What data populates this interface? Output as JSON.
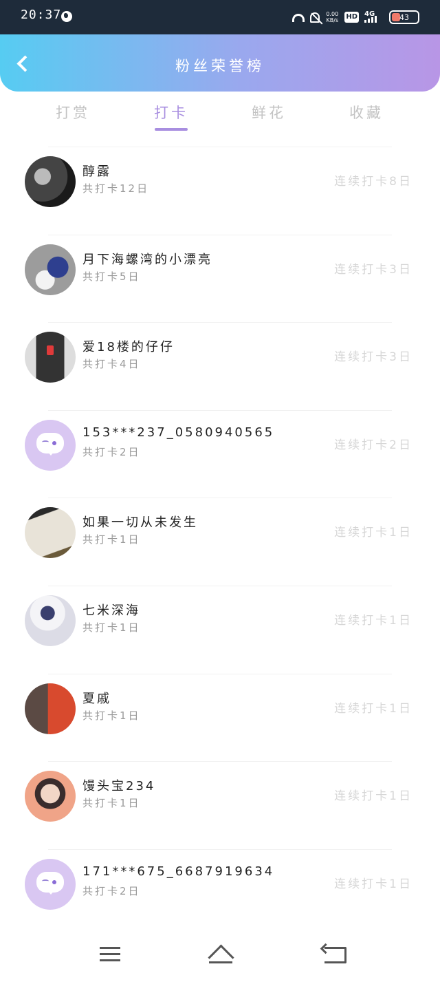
{
  "status_bar": {
    "time": "20:37",
    "net_speed_value": "0.00",
    "net_speed_unit": "KB/s",
    "hd_label": "HD",
    "network_label": "4G",
    "battery_level": "43"
  },
  "header": {
    "title": "粉丝荣誉榜"
  },
  "tabs": [
    {
      "label": "打赏",
      "active": false
    },
    {
      "label": "打卡",
      "active": true
    },
    {
      "label": "鲜花",
      "active": false
    },
    {
      "label": "收藏",
      "active": false
    }
  ],
  "fans": [
    {
      "name": "醇露",
      "total": "共打卡12日",
      "streak": "连续打卡8日",
      "avatar": "dark-photo"
    },
    {
      "name": "月下海螺湾的小漂亮",
      "total": "共打卡5日",
      "streak": "连续打卡3日",
      "avatar": "girl-photo"
    },
    {
      "name": "爱18楼的仔仔",
      "total": "共打卡4日",
      "streak": "连续打卡3日",
      "avatar": "traffic-light-photo"
    },
    {
      "name": "153***237_0580940565",
      "total": "共打卡2日",
      "streak": "连续打卡2日",
      "avatar": "default-chat-bubble"
    },
    {
      "name": "如果一切从未发生",
      "total": "共打卡1日",
      "streak": "连续打卡1日",
      "avatar": "note-photo"
    },
    {
      "name": "七米深海",
      "total": "共打卡1日",
      "streak": "连续打卡1日",
      "avatar": "astronaut-photo"
    },
    {
      "name": "夏戚",
      "total": "共打卡1日",
      "streak": "连续打卡1日",
      "avatar": "couple-photo"
    },
    {
      "name": "馒头宝234",
      "total": "共打卡1日",
      "streak": "连续打卡1日",
      "avatar": "boy-photo"
    },
    {
      "name": "171***675_6687919634",
      "total": "共打卡2日",
      "streak": "连续打卡1日",
      "avatar": "default-chat-bubble"
    }
  ],
  "colors": {
    "header_gradient_start": "#56ccf2",
    "header_gradient_end": "#b896e6",
    "active_tab": "#a88ee0",
    "inactive_tab": "#c3c3c3"
  }
}
